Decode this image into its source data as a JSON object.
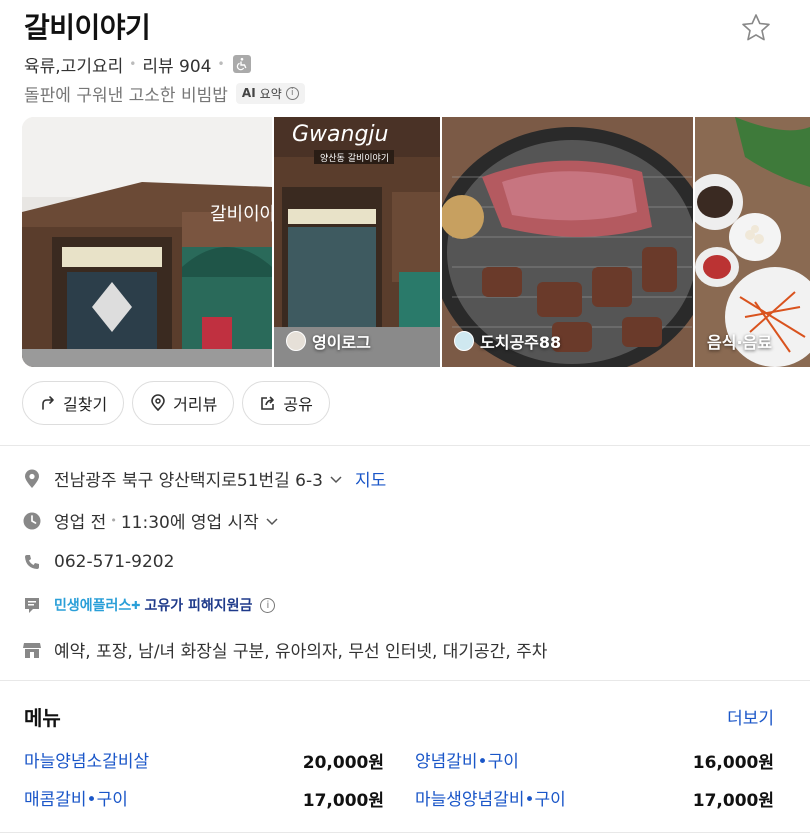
{
  "place": {
    "name": "갈비이야기",
    "category": "육류,고기요리",
    "review_label": "리뷰 904",
    "description": "돌판에 구워낸 고소한 비빔밥",
    "ai_label": "AI",
    "ai_summary_label": "요약"
  },
  "photos": [
    {
      "caption": "",
      "icon": "storefront-photo"
    },
    {
      "caption": "영이로그",
      "icon": "avatar",
      "sign_text": "Gwangju",
      "sign_sub": "양산동 갈비이야기"
    },
    {
      "caption": "도치공주88",
      "icon": "avatar"
    },
    {
      "caption": "음식·음료",
      "icon": "none"
    }
  ],
  "actions": {
    "directions": "길찾기",
    "street_view": "거리뷰",
    "share": "공유"
  },
  "info": {
    "address": "전남광주 북구 양산택지로51번길 6-3",
    "map_link": "지도",
    "status": "영업 전",
    "hours": "11:30에 영업 시작",
    "phone": "062-571-9202",
    "promo_brand": "민생에플러스",
    "promo_text": "고유가 피해지원금",
    "amenities": "예약, 포장, 남/녀 화장실 구분, 유아의자, 무선 인터넷, 대기공간, 주차"
  },
  "menu": {
    "title": "메뉴",
    "more": "더보기",
    "items": [
      {
        "name": "마늘양념소갈비살",
        "price": "20,000원"
      },
      {
        "name": "양념갈비•구이",
        "price": "16,000원"
      },
      {
        "name": "매콤갈비•구이",
        "price": "17,000원"
      },
      {
        "name": "마늘생양념갈비•구이",
        "price": "17,000원"
      }
    ]
  },
  "colors": {
    "link": "#1a56c8",
    "promo_blue": "#2a9fd8",
    "promo_navy": "#1e3a8a"
  }
}
